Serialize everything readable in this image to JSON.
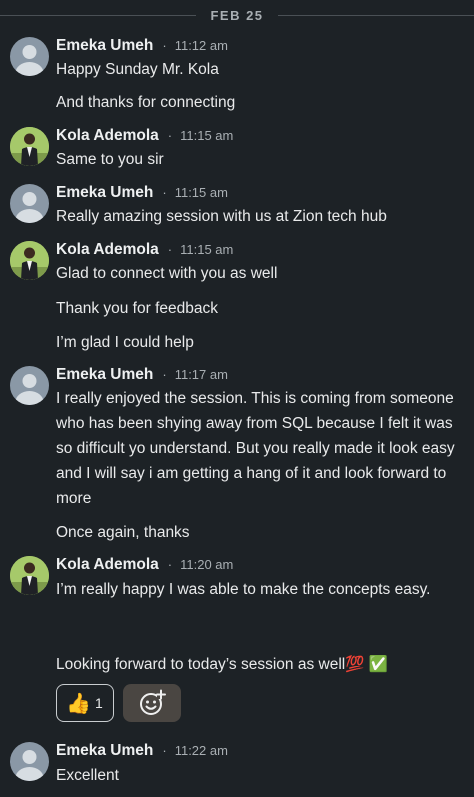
{
  "date_separator": "FEB 25",
  "messages": [
    {
      "sender": "Emeka Umeh",
      "time": "11:12 am",
      "lines": [
        "Happy Sunday Mr. Kola",
        "And thanks for connecting"
      ]
    },
    {
      "sender": "Kola Ademola",
      "time": "11:15 am",
      "lines": [
        "Same to you sir"
      ]
    },
    {
      "sender": "Emeka Umeh",
      "time": "11:15 am",
      "lines": [
        "Really amazing session with us at Zion tech hub"
      ]
    },
    {
      "sender": "Kola Ademola",
      "time": "11:15 am",
      "lines": [
        "Glad to connect with you as well",
        "Thank you for feedback",
        "I’m glad I could help"
      ]
    },
    {
      "sender": "Emeka Umeh",
      "time": "11:17 am",
      "lines": [
        "I really enjoyed the session. This is coming from someone who has been shying away from SQL because I felt it was so difficult yo understand. But you really made it look easy and I will say i am getting a hang of it and look forward to more",
        "Once again, thanks"
      ]
    },
    {
      "sender": "Kola Ademola",
      "time": "11:20 am",
      "lines": [
        "I’m really happy I was able to make the concepts easy.",
        "Looking forward to today’s session as well💯 ✅"
      ]
    },
    {
      "sender": "Emeka Umeh",
      "time": "11:22 am",
      "lines": [
        "Excellent"
      ]
    }
  ],
  "reactions": {
    "thumbs_up": {
      "emoji": "👍",
      "count": "1"
    },
    "add_reaction_icon": "add-reaction-icon"
  },
  "separator_dot": "·",
  "colors": {
    "background": "#1d2226",
    "text": "#e9eaeb",
    "muted": "#a9afb3"
  }
}
